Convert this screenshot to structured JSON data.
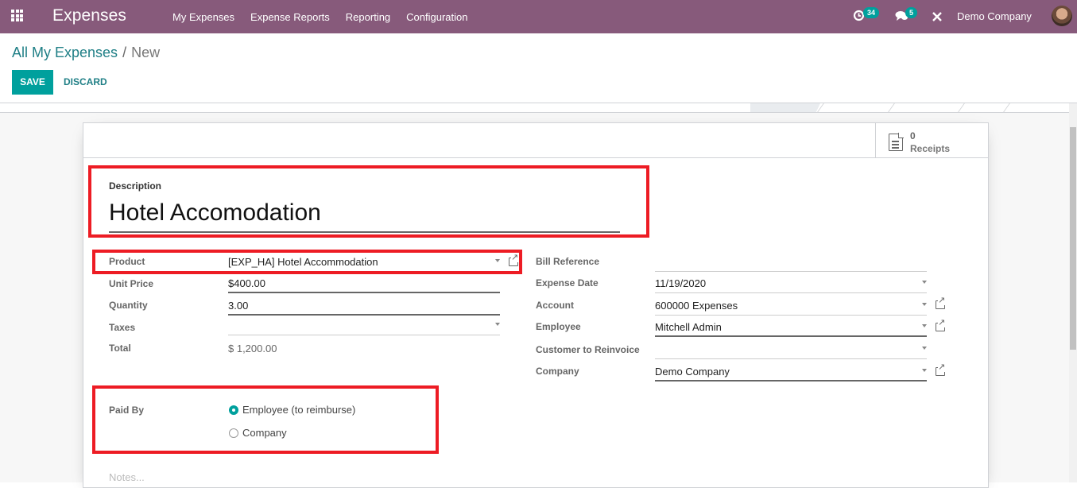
{
  "navbar": {
    "app_title": "Expenses",
    "menu": [
      "My Expenses",
      "Expense Reports",
      "Reporting",
      "Configuration"
    ],
    "activity_count": "34",
    "message_count": "5",
    "company": "Demo Company",
    "icons": [
      "apps-grid-icon",
      "activity-clock-icon",
      "chat-icon",
      "debug-tools-icon",
      "user-avatar"
    ]
  },
  "breadcrumb": {
    "parent": "All My Expenses",
    "separator": "/",
    "current": "New"
  },
  "buttons": {
    "save": "SAVE",
    "discard": "DISCARD"
  },
  "smart_buttons": {
    "receipts_count": "0",
    "receipts_label": "Receipts"
  },
  "form": {
    "description_label": "Description",
    "description_value": "Hotel Accomodation",
    "left": {
      "product_label": "Product",
      "product_value": "[EXP_HA] Hotel Accommodation",
      "unit_price_label": "Unit Price",
      "unit_price_value": "$400.00",
      "quantity_label": "Quantity",
      "quantity_value": "3.00",
      "taxes_label": "Taxes",
      "taxes_value": "",
      "total_label": "Total",
      "total_value": "$ 1,200.00"
    },
    "right": {
      "bill_ref_label": "Bill Reference",
      "bill_ref_value": "",
      "date_label": "Expense Date",
      "date_value": "11/19/2020",
      "account_label": "Account",
      "account_value": "600000 Expenses",
      "employee_label": "Employee",
      "employee_value": "Mitchell Admin",
      "customer_label": "Customer to Reinvoice",
      "customer_value": "",
      "company_label": "Company",
      "company_value": "Demo Company"
    },
    "paid_by": {
      "label": "Paid By",
      "options": [
        "Employee (to reimburse)",
        "Company"
      ],
      "selected": "Employee (to reimburse)"
    },
    "notes_placeholder": "Notes..."
  },
  "colors": {
    "navbar": "#875a7b",
    "primary": "#00a09d",
    "link": "#1f7f86",
    "highlight_box": "#ed1c24"
  }
}
